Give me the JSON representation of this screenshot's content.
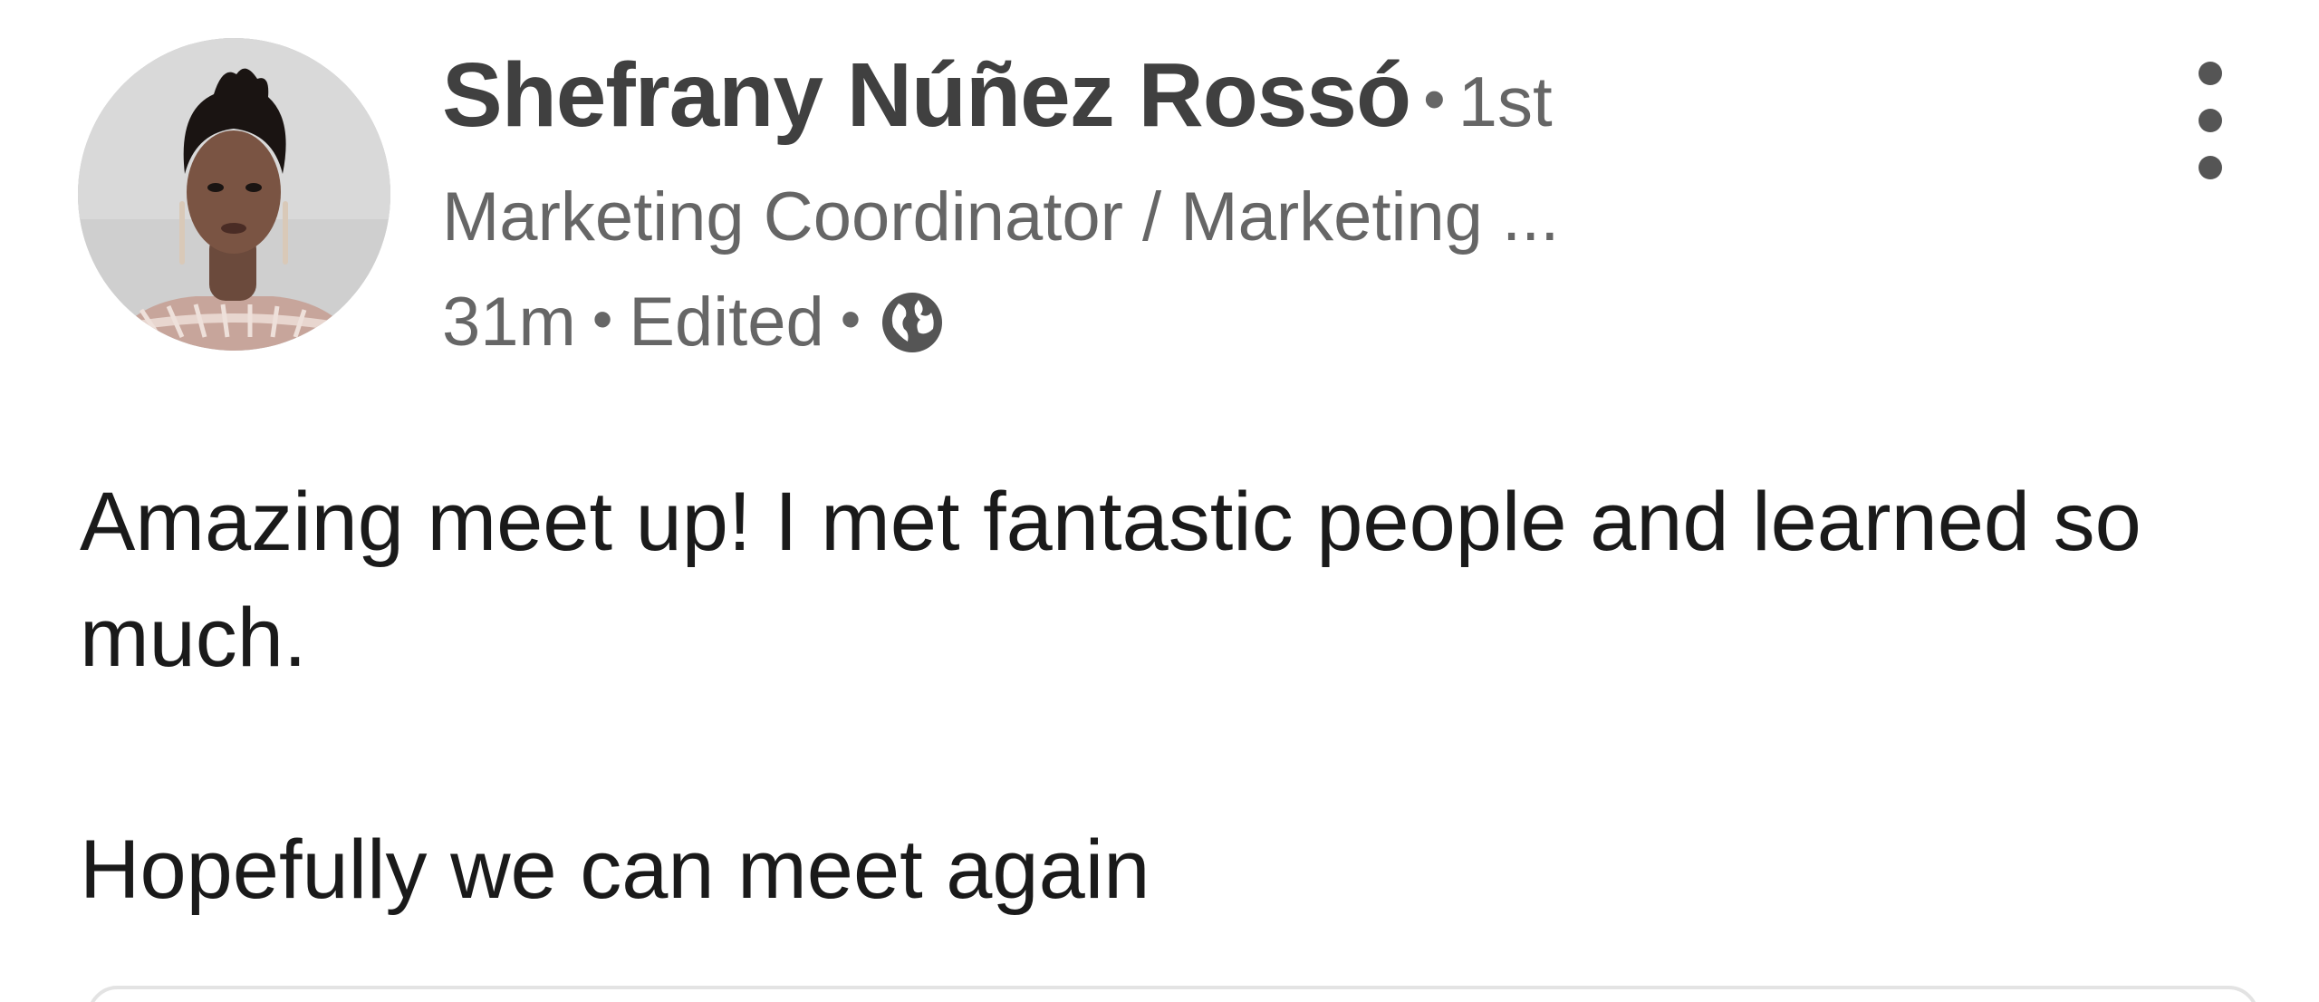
{
  "author": {
    "name": "Shefrany Núñez Rossó",
    "degree_separator": "•",
    "degree": "1st",
    "headline": "Marketing Coordinator / Marketing ...",
    "avatar_icon": "avatar-photo"
  },
  "meta": {
    "time": "31m",
    "separator": "•",
    "edited": "Edited",
    "visibility_icon": "globe-icon"
  },
  "menu": {
    "icon": "more-vertical-icon"
  },
  "post": {
    "line1": "Amazing meet up! I met fantastic people and learned so much.",
    "line2": "Hopefully we can meet again"
  },
  "colors": {
    "name": "#404040",
    "secondary": "#666666",
    "body": "#1a1a1a",
    "card_border": "#e3e3e3"
  }
}
